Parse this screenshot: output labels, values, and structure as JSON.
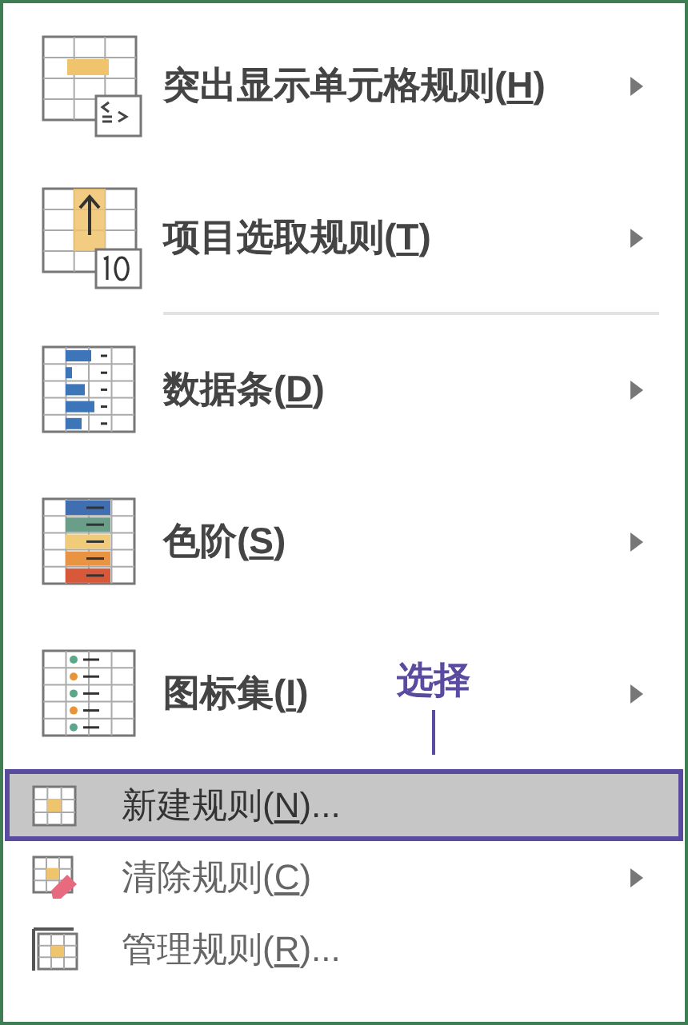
{
  "menu_items": [
    {
      "kind": "highlight",
      "text_before": "突出显示单元格规则(",
      "mnemonic": "H",
      "text_after": ")",
      "submenu": true,
      "selected": false,
      "separator_after": false
    },
    {
      "kind": "top10",
      "text_before": "项目选取规则(",
      "mnemonic": "T",
      "text_after": ")",
      "submenu": true,
      "selected": false,
      "separator_after": true
    },
    {
      "kind": "databar",
      "text_before": "数据条(",
      "mnemonic": "D",
      "text_after": ")",
      "submenu": true,
      "selected": false,
      "separator_after": false
    },
    {
      "kind": "colorscale",
      "text_before": "色阶(",
      "mnemonic": "S",
      "text_after": ")",
      "submenu": true,
      "selected": false,
      "separator_after": false
    },
    {
      "kind": "iconset",
      "text_before": "图标集(",
      "mnemonic": "I",
      "text_after": ")",
      "submenu": true,
      "selected": false,
      "separator_after": false
    },
    {
      "kind": "new",
      "text_before": "新建规则(",
      "mnemonic": "N",
      "text_after": ")...",
      "submenu": false,
      "selected": true,
      "separator_after": false
    },
    {
      "kind": "clear",
      "text_before": "清除规则(",
      "mnemonic": "C",
      "text_after": ")",
      "submenu": true,
      "selected": false,
      "separator_after": false
    },
    {
      "kind": "manage",
      "text_before": "管理规则(",
      "mnemonic": "R",
      "text_after": ")...",
      "submenu": false,
      "selected": false,
      "separator_after": false
    }
  ],
  "annotation": {
    "text": "选择"
  }
}
